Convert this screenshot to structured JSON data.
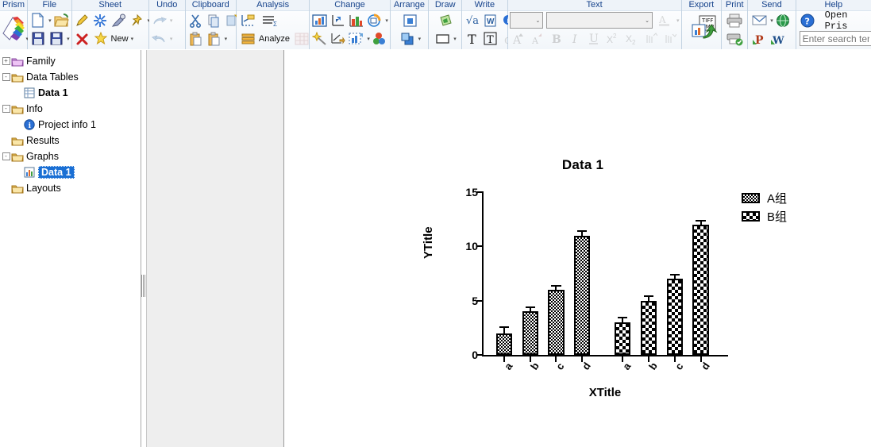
{
  "ribbon": {
    "groups": [
      {
        "title": "Prism",
        "items": [
          {
            "name": "prism-logo-icon",
            "label": ""
          }
        ]
      },
      {
        "title": "File",
        "items": [
          {
            "name": "new-file-icon",
            "label": ""
          },
          {
            "name": "open-file-icon",
            "label": ""
          },
          {
            "name": "save-icon",
            "label": ""
          },
          {
            "name": "save-as-icon",
            "label": ""
          }
        ]
      },
      {
        "title": "Sheet",
        "items": [
          {
            "name": "pencil-icon",
            "label": ""
          },
          {
            "name": "freeze-icon",
            "label": ""
          },
          {
            "name": "analyze-pen-icon",
            "label": ""
          },
          {
            "name": "pin-icon",
            "label": ""
          },
          {
            "name": "delete-sheet-icon",
            "label": ""
          },
          {
            "name": "new-sheet-icon",
            "label": "New"
          }
        ]
      },
      {
        "title": "Undo",
        "items": [
          {
            "name": "redo-icon",
            "label": ""
          },
          {
            "name": "undo-icon",
            "label": ""
          }
        ]
      },
      {
        "title": "Clipboard",
        "items": [
          {
            "name": "cut-icon",
            "label": ""
          },
          {
            "name": "copy-icon",
            "label": ""
          },
          {
            "name": "duplicate-icon",
            "label": ""
          },
          {
            "name": "paste-icon",
            "label": ""
          },
          {
            "name": "paste-special-icon",
            "label": ""
          }
        ]
      },
      {
        "title": "Analysis",
        "items": [
          {
            "name": "interpolate-icon",
            "label": ""
          },
          {
            "name": "results-icon",
            "label": ""
          },
          {
            "name": "analyze-icon",
            "label": "Analyze"
          },
          {
            "name": "analysis-grid-icon",
            "label": ""
          }
        ]
      },
      {
        "title": "Change",
        "items": [
          {
            "name": "graph-type-icon",
            "label": ""
          },
          {
            "name": "axis-icon",
            "label": ""
          },
          {
            "name": "bar-format-icon",
            "label": ""
          },
          {
            "name": "change-colors-icon",
            "label": ""
          },
          {
            "name": "magic-icon",
            "label": ""
          },
          {
            "name": "add-axis-icon",
            "label": ""
          },
          {
            "name": "data-sets-icon",
            "label": ""
          },
          {
            "name": "color-scheme-icon",
            "label": ""
          }
        ]
      },
      {
        "title": "Arrange",
        "items": [
          {
            "name": "center-icon",
            "label": ""
          },
          {
            "name": "bring-front-icon",
            "label": ""
          }
        ]
      },
      {
        "title": "Draw",
        "items": [
          {
            "name": "shapes-icon",
            "label": ""
          },
          {
            "name": "rectangle-icon",
            "label": ""
          }
        ]
      },
      {
        "title": "Write",
        "items": [
          {
            "name": "equation-icon",
            "label": ""
          },
          {
            "name": "word-icon",
            "label": ""
          },
          {
            "name": "info-text-icon",
            "label": ""
          },
          {
            "name": "text-icon",
            "label": ""
          },
          {
            "name": "text-box-icon",
            "label": ""
          },
          {
            "name": "greek-icon",
            "label": ""
          }
        ]
      },
      {
        "title": "Text",
        "items": [
          {
            "name": "font-size-select",
            "label": ""
          },
          {
            "name": "font-family-select",
            "label": ""
          },
          {
            "name": "font-color-icon",
            "label": ""
          },
          {
            "name": "grow-font-icon",
            "label": ""
          },
          {
            "name": "shrink-font-icon",
            "label": ""
          },
          {
            "name": "bold-icon",
            "label": "B"
          },
          {
            "name": "italic-icon",
            "label": "I"
          },
          {
            "name": "underline-icon",
            "label": "U"
          },
          {
            "name": "superscript-icon",
            "label": ""
          },
          {
            "name": "subscript-icon",
            "label": ""
          },
          {
            "name": "move-up-icon",
            "label": ""
          },
          {
            "name": "move-down-icon",
            "label": ""
          },
          {
            "name": "align-icon",
            "label": ""
          }
        ]
      },
      {
        "title": "Export",
        "items": [
          {
            "name": "export-tiff-bmp-icon",
            "label": ""
          }
        ]
      },
      {
        "title": "Print",
        "items": [
          {
            "name": "print-icon",
            "label": ""
          },
          {
            "name": "print-preview-icon",
            "label": ""
          }
        ]
      },
      {
        "title": "Send",
        "items": [
          {
            "name": "email-icon",
            "label": ""
          },
          {
            "name": "web-icon",
            "label": ""
          },
          {
            "name": "powerpoint-icon",
            "label": ""
          },
          {
            "name": "word-send-icon",
            "label": ""
          }
        ]
      },
      {
        "title": "Help",
        "items": [
          {
            "name": "help-icon",
            "label": ""
          },
          {
            "name": "open-prism-guide-link",
            "label": "Open Pris"
          }
        ]
      }
    ],
    "text_group": {
      "font_size_value": "",
      "font_family_value": "",
      "bold_label": "B",
      "italic_label": "I",
      "underline_label": "U",
      "superscript_label": "X",
      "subscript_label": "X"
    },
    "analysis_group": {
      "analyze_label": "Analyze"
    },
    "sheet_group": {
      "new_label": "New"
    },
    "help_group": {
      "open_link_label": "Open Pris",
      "search_placeholder": "Enter search term"
    }
  },
  "navigator": {
    "items": [
      {
        "label": "Family",
        "icon": "folder-purple-icon",
        "indent": 1,
        "expander": "+",
        "bold": false,
        "selected": false
      },
      {
        "label": "Data Tables",
        "icon": "folder-yellow-icon",
        "indent": 1,
        "expander": "-",
        "bold": false,
        "selected": false
      },
      {
        "label": "Data 1",
        "icon": "data-table-icon",
        "indent": 2,
        "expander": "",
        "bold": true,
        "selected": false
      },
      {
        "label": "Info",
        "icon": "folder-yellow-icon",
        "indent": 1,
        "expander": "-",
        "bold": false,
        "selected": false
      },
      {
        "label": "Project info 1",
        "icon": "info-circle-icon",
        "indent": 2,
        "expander": "",
        "bold": false,
        "selected": false
      },
      {
        "label": "Results",
        "icon": "folder-yellow-icon",
        "indent": 1,
        "expander": "",
        "bold": false,
        "selected": false
      },
      {
        "label": "Graphs",
        "icon": "folder-yellow-icon",
        "indent": 1,
        "expander": "-",
        "bold": false,
        "selected": false
      },
      {
        "label": "Data 1",
        "icon": "graph-icon",
        "indent": 2,
        "expander": "",
        "bold": true,
        "selected": true
      },
      {
        "label": "Layouts",
        "icon": "folder-yellow-icon",
        "indent": 1,
        "expander": "",
        "bold": false,
        "selected": false
      }
    ]
  },
  "chart_data": {
    "type": "bar",
    "title": "Data 1",
    "xlabel": "XTitle",
    "ylabel": "YTitle",
    "categories": [
      "a",
      "b",
      "c",
      "d"
    ],
    "xtick_labels": [
      "a",
      "b",
      "c",
      "d",
      "a",
      "b",
      "c",
      "d"
    ],
    "ylim": [
      0,
      15
    ],
    "yticks": [
      0,
      5,
      10,
      15
    ],
    "ytick_labels": [
      "0",
      "5",
      "10",
      "15"
    ],
    "grid": false,
    "legend_position": "right",
    "series": [
      {
        "name": "A组",
        "pattern": "fine-checker",
        "values": [
          2,
          4,
          6,
          11
        ],
        "errors": [
          0.6,
          0.5,
          0.45,
          0.5
        ]
      },
      {
        "name": "B组",
        "pattern": "coarse-checker",
        "values": [
          3,
          5,
          7,
          12
        ],
        "errors": [
          0.5,
          0.5,
          0.5,
          0.45
        ]
      }
    ]
  },
  "legend": {
    "entries": [
      {
        "label": "A组",
        "pattern": "fine-checker"
      },
      {
        "label": "B组",
        "pattern": "coarse-checker"
      }
    ]
  }
}
